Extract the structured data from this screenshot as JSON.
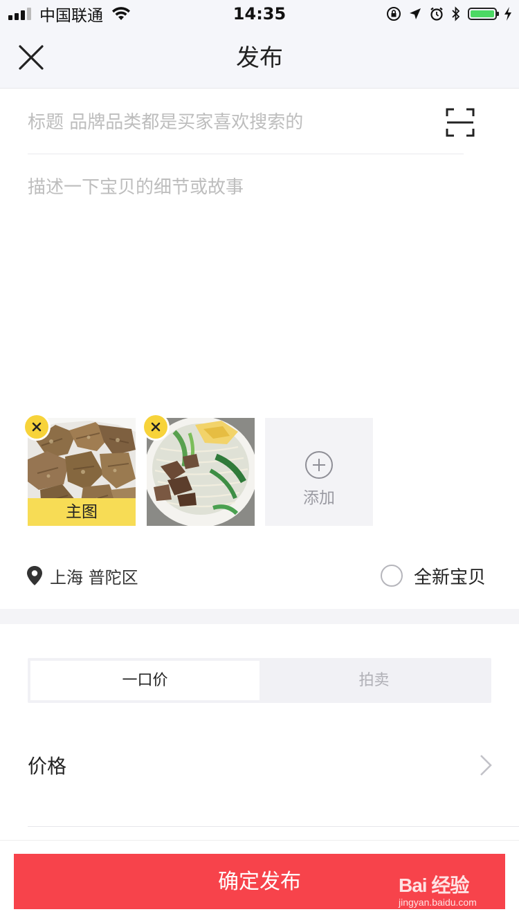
{
  "status_bar": {
    "carrier": "中国联通",
    "time": "14:35",
    "battery_level": 1.0,
    "battery_color": "#4cd964"
  },
  "nav": {
    "title": "发布",
    "close_icon": "close-icon"
  },
  "form": {
    "title_placeholder": "标题 品牌品类都是买家喜欢搜索的",
    "title_value": "",
    "scan_icon": "scan-icon",
    "description_placeholder": "描述一下宝贝的细节或故事",
    "description_value": ""
  },
  "photos": {
    "items": [
      {
        "tag": "主图",
        "alt": "beef photo"
      },
      {
        "tag": "",
        "alt": "noodle soup photo"
      }
    ],
    "add_label": "添加",
    "remove_icon": "remove-photo-icon",
    "main_tag_color": "#f7dc55",
    "remove_color": "#f7d33a"
  },
  "location": {
    "text": "上海 普陀区",
    "icon": "location-pin-icon"
  },
  "condition": {
    "label": "全新宝贝",
    "checked": false
  },
  "sale_type": {
    "tabs": [
      {
        "label": "一口价",
        "active": true
      },
      {
        "label": "拍卖",
        "active": false
      }
    ]
  },
  "price": {
    "label": "价格",
    "icon": "chevron-right-icon"
  },
  "submit": {
    "label": "确定发布",
    "color": "#f7434b"
  },
  "watermark": {
    "logo": "Bai 经验",
    "url": "jingyan.baidu.com"
  }
}
